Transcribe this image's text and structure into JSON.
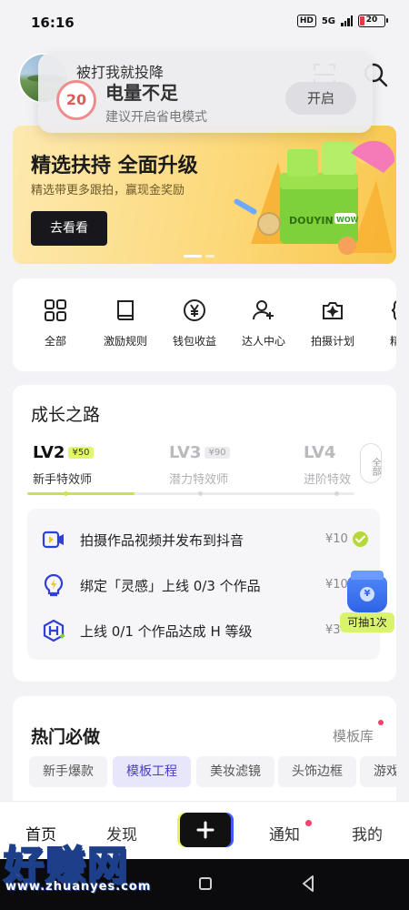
{
  "status_bar": {
    "time": "16:16",
    "hd": "HD",
    "network": "5G",
    "battery": "20"
  },
  "header": {
    "icons": [
      "scan-icon",
      "search-icon"
    ]
  },
  "notification": {
    "user": "被打我就投降",
    "battery_level": "20",
    "title": "电量不足",
    "subtitle": "建议开启省电模式",
    "button": "开启"
  },
  "banner": {
    "title": "精选扶持 全面升级",
    "subtitle": "精选带更多跟拍，赢现金奖励",
    "button": "去看看",
    "art_text": [
      "DOUYIN",
      "WOW"
    ]
  },
  "quick_actions": [
    {
      "label": "全部",
      "icon": "grid-icon"
    },
    {
      "label": "激励规则",
      "icon": "book-icon"
    },
    {
      "label": "钱包收益",
      "icon": "yen-icon"
    },
    {
      "label": "达人中心",
      "icon": "user-plus-icon"
    },
    {
      "label": "拍摄计划",
      "icon": "camera-sparkle-icon"
    },
    {
      "label": "精选",
      "icon": "bracket-icon"
    }
  ],
  "growth": {
    "title": "成长之路",
    "levels": [
      {
        "name": "LV2",
        "reward": "¥50",
        "desc": "新手特效师"
      },
      {
        "name": "LV3",
        "reward": "¥90",
        "desc": "潜力特效师"
      },
      {
        "name": "LV4",
        "reward": "",
        "desc": "进阶特效"
      }
    ],
    "all_button": "全部",
    "tasks": [
      {
        "text": "拍摄作品视频并发布到抖音",
        "reward": "¥10",
        "icon": "video-icon",
        "done": true
      },
      {
        "text": "绑定「灵感」上线 0/3 个作品",
        "reward": "¥10",
        "icon": "lightning-icon",
        "done": false
      },
      {
        "text": "上线 0/1 个作品达成 H 等级",
        "reward": "¥3",
        "icon": "h-badge-icon",
        "done": false
      }
    ],
    "lottery": {
      "label": "可抽1次",
      "coin": "¥"
    }
  },
  "hot": {
    "title": "热门必做",
    "link": "模板库",
    "chips": [
      "新手爆款",
      "模板工程",
      "美妆滤镜",
      "头饰边框",
      "游戏"
    ],
    "active_chip": "模板工程"
  },
  "tab_bar": {
    "tabs": [
      "首页",
      "发现",
      "通知",
      "我的"
    ]
  },
  "watermark": {
    "text": "好赚网",
    "url": "www.zhuanyes.com"
  },
  "colors": {
    "accent_lime": "#c7e54a",
    "accent_purple": "#4a3fc4",
    "notification_dot": "#f0456a"
  }
}
